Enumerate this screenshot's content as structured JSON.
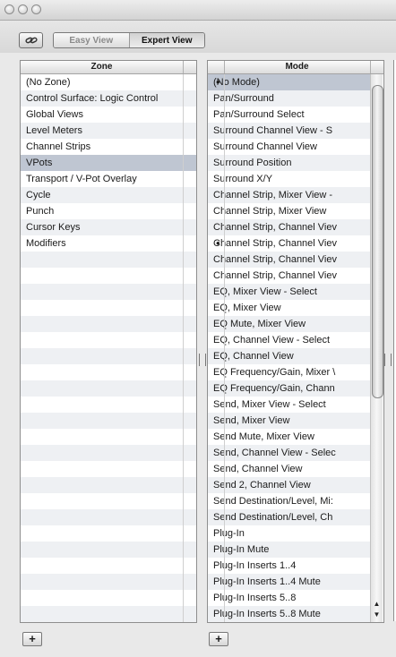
{
  "toolbar": {
    "easy_view_label": "Easy View",
    "expert_view_label": "Expert View",
    "selected_view": "Expert View",
    "link_icon": "link-icon"
  },
  "zone": {
    "header": "Zone",
    "items": [
      {
        "label": "(No Zone)",
        "selected": false
      },
      {
        "label": "Control Surface: Logic Control",
        "selected": false
      },
      {
        "label": "Global Views",
        "selected": false
      },
      {
        "label": "Level Meters",
        "selected": false
      },
      {
        "label": "Channel Strips",
        "selected": false
      },
      {
        "label": "VPots",
        "selected": true
      },
      {
        "label": "Transport / V-Pot Overlay",
        "selected": false
      },
      {
        "label": "Cycle",
        "selected": false
      },
      {
        "label": "Punch",
        "selected": false
      },
      {
        "label": "Cursor Keys",
        "selected": false
      },
      {
        "label": "Modifiers",
        "selected": false
      }
    ]
  },
  "mode": {
    "header": "Mode",
    "items": [
      {
        "label": "(No Mode)",
        "bullet": true,
        "selected": true
      },
      {
        "label": "Pan/Surround",
        "bullet": false,
        "selected": false
      },
      {
        "label": "Pan/Surround Select",
        "bullet": false,
        "selected": false
      },
      {
        "label": "Surround Channel View - S",
        "bullet": false,
        "selected": false
      },
      {
        "label": "Surround Channel View",
        "bullet": false,
        "selected": false
      },
      {
        "label": "Surround Position",
        "bullet": false,
        "selected": false
      },
      {
        "label": "Surround X/Y",
        "bullet": false,
        "selected": false
      },
      {
        "label": "Channel Strip, Mixer View -",
        "bullet": false,
        "selected": false
      },
      {
        "label": "Channel Strip, Mixer View",
        "bullet": false,
        "selected": false
      },
      {
        "label": "Channel Strip, Channel Viev",
        "bullet": false,
        "selected": false
      },
      {
        "label": "Channel Strip, Channel Viev",
        "bullet": true,
        "selected": false
      },
      {
        "label": "Channel Strip, Channel Viev",
        "bullet": false,
        "selected": false
      },
      {
        "label": "Channel Strip, Channel Viev",
        "bullet": false,
        "selected": false
      },
      {
        "label": "EQ, Mixer View - Select",
        "bullet": false,
        "selected": false
      },
      {
        "label": "EQ, Mixer View",
        "bullet": false,
        "selected": false
      },
      {
        "label": "EQ Mute, Mixer View",
        "bullet": false,
        "selected": false
      },
      {
        "label": "EQ, Channel View - Select",
        "bullet": false,
        "selected": false
      },
      {
        "label": "EQ, Channel View",
        "bullet": false,
        "selected": false
      },
      {
        "label": "EQ Frequency/Gain, Mixer \\",
        "bullet": false,
        "selected": false
      },
      {
        "label": "EQ Frequency/Gain, Chann",
        "bullet": false,
        "selected": false
      },
      {
        "label": "Send, Mixer View - Select",
        "bullet": false,
        "selected": false
      },
      {
        "label": "Send, Mixer View",
        "bullet": false,
        "selected": false
      },
      {
        "label": "Send Mute, Mixer View",
        "bullet": false,
        "selected": false
      },
      {
        "label": "Send, Channel View - Selec",
        "bullet": false,
        "selected": false
      },
      {
        "label": "Send, Channel View",
        "bullet": false,
        "selected": false
      },
      {
        "label": "Send 2, Channel View",
        "bullet": false,
        "selected": false
      },
      {
        "label": "Send Destination/Level, Mi:",
        "bullet": false,
        "selected": false
      },
      {
        "label": "Send Destination/Level, Ch",
        "bullet": false,
        "selected": false
      },
      {
        "label": "Plug-In",
        "bullet": false,
        "selected": false
      },
      {
        "label": "Plug-In Mute",
        "bullet": false,
        "selected": false
      },
      {
        "label": "Plug-In Inserts 1..4",
        "bullet": false,
        "selected": false
      },
      {
        "label": "Plug-In Inserts 1..4 Mute",
        "bullet": false,
        "selected": false
      },
      {
        "label": "Plug-In Inserts 5..8",
        "bullet": false,
        "selected": false
      },
      {
        "label": "Plug-In Inserts 5..8 Mute",
        "bullet": false,
        "selected": false
      }
    ]
  },
  "footer": {
    "add_zone_label": "+",
    "add_mode_label": "+"
  },
  "colors": {
    "selection": "#bfc6d2",
    "stripe": "#eef0f3"
  }
}
